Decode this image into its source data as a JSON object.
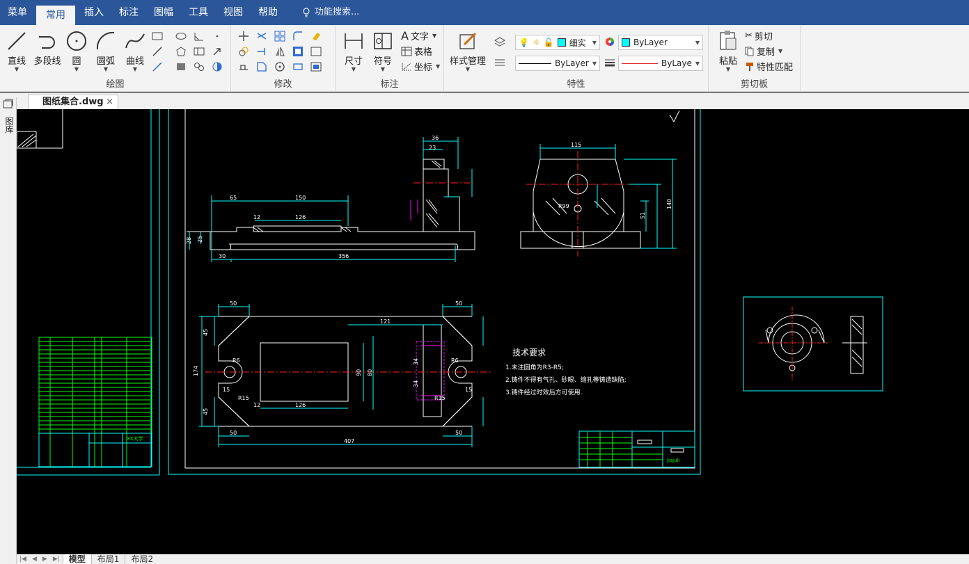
{
  "menu": {
    "items": [
      "菜单",
      "常用",
      "插入",
      "标注",
      "图幅",
      "工具",
      "视图",
      "帮助"
    ],
    "active": "常用",
    "search_placeholder": "功能搜索..."
  },
  "ribbon": {
    "draw": {
      "label": "绘图",
      "line": "直线",
      "polyline": "多段线",
      "circle": "圆",
      "arc": "圆弧",
      "curve": "曲线"
    },
    "modify": {
      "label": "修改"
    },
    "annotate": {
      "label": "标注",
      "dimension": "尺寸",
      "symbol": "符号",
      "text": "文字",
      "table": "表格",
      "coordinate": "坐标"
    },
    "properties": {
      "label": "特性",
      "style_manager": "样式管理",
      "layer_name": "细实",
      "color_value": "ByLayer",
      "linetype_value": "ByLayer",
      "lineweight_value": "ByLaye",
      "color_swatch": "#00ffff",
      "lineweight_color": "#e02020"
    },
    "clipboard": {
      "label": "剪切板",
      "paste": "粘贴",
      "cut": "剪切",
      "copy": "复制",
      "match": "特性匹配"
    }
  },
  "side_panel": {
    "label": "图库"
  },
  "document_tab": {
    "name": "图纸集合.dwg",
    "close": "×"
  },
  "layout_tabs": [
    "模型",
    "布局1",
    "布局2"
  ],
  "drawing": {
    "colors": {
      "frame": "#00ffff",
      "geometry": "#ffffff",
      "center": "#ff2020",
      "dim": "#00ffff",
      "green": "#00ff00",
      "magenta": "#ff00ff"
    },
    "dims_front": [
      "65",
      "150",
      "12",
      "126",
      "28",
      "25",
      "30",
      "356"
    ],
    "dims_side": [
      "36",
      "23"
    ],
    "dims_right": [
      "115",
      "140",
      "51",
      "R99"
    ],
    "dims_plan": [
      "50",
      "121",
      "50",
      "45",
      "174",
      "45",
      "90",
      "80",
      "34",
      "34",
      "R15",
      "R6",
      "R15",
      "R6",
      "15",
      "12",
      "126",
      "15",
      "50",
      "407",
      "50"
    ],
    "tech_title": "技术要求",
    "tech_lines": [
      "1.未注圆角为R3-R5;",
      "2.铸件不得有气孔、砂眼、缩孔等铸造缺陷;",
      "3.铸件经过时效后方可使用."
    ],
    "title_block_left": "XX大学",
    "title_block_right": "jiajuli"
  }
}
